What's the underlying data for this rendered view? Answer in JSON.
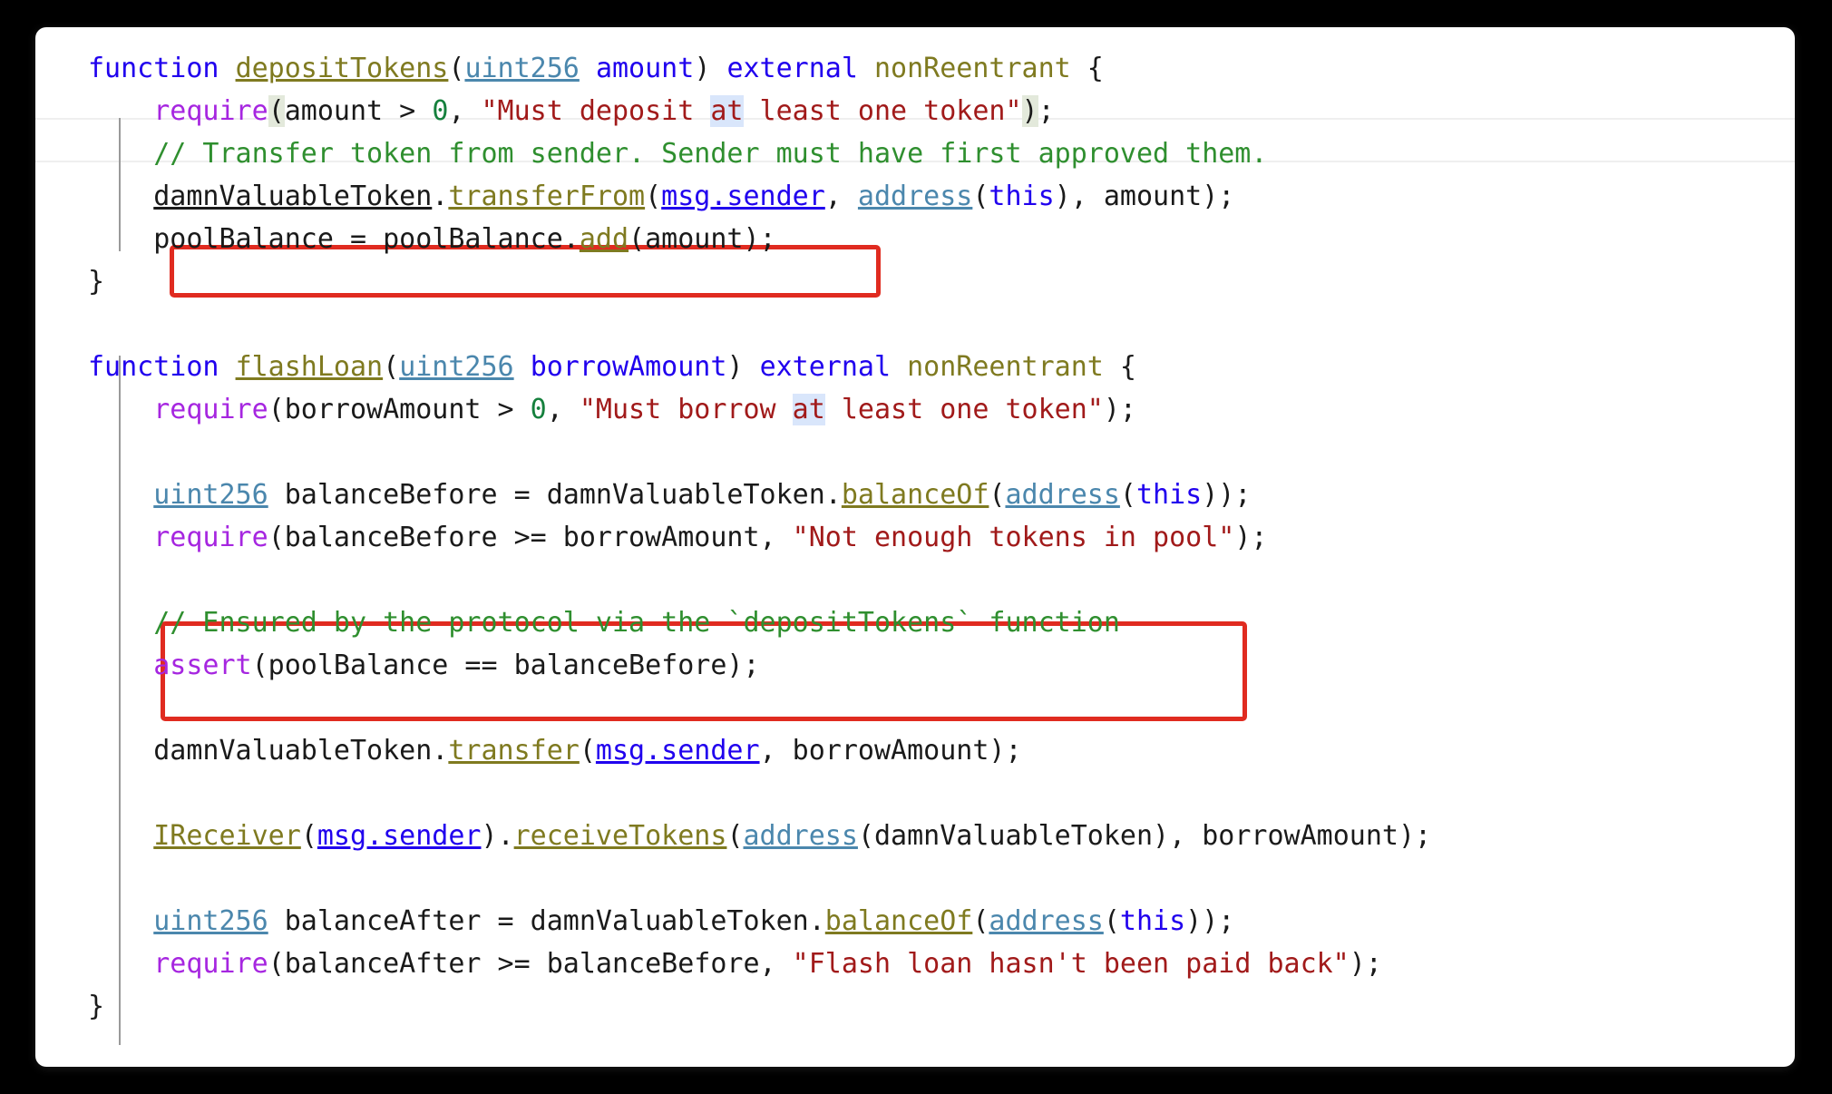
{
  "window": {
    "kind": "code-snippet-screenshot",
    "background_color": "#000000",
    "card_color": "#ffffff",
    "language": "Solidity"
  },
  "theme": {
    "keyword_color": "#2000ee",
    "function_color": "#7f7a20",
    "type_color": "#4b87ad",
    "builtin_color": "#a626e0",
    "string_color": "#a11a1a",
    "number_color": "#15803d",
    "comment_color": "#2f8f2f",
    "text_color": "#1a1a1a",
    "bracket_match_bg": "#e3e9db",
    "occurrence_bg": "#d9e6fb",
    "annotation_box_color": "#e02b20",
    "current_line_rule": "#efefef",
    "indent_guide": "#9a9a9a"
  },
  "annotations": [
    {
      "id": "redbox-1",
      "label": "pool-balance-update-highlight",
      "targets": "poolBalance = poolBalance.add(amount);"
    },
    {
      "id": "redbox-2",
      "label": "assert-invariant-highlight",
      "targets": "// Ensured by the protocol via the `depositTokens` function / assert(poolBalance == balanceBefore);"
    }
  ],
  "code": {
    "lines": [
      "function depositTokens(uint256 amount) external nonReentrant {",
      "    require(amount > 0, \"Must deposit at least one token\");",
      "    // Transfer token from sender. Sender must have first approved them.",
      "    damnValuableToken.transferFrom(msg.sender, address(this), amount);",
      "    poolBalance = poolBalance.add(amount);",
      "}",
      "",
      "function flashLoan(uint256 borrowAmount) external nonReentrant {",
      "    require(borrowAmount > 0, \"Must borrow at least one token\");",
      "",
      "    uint256 balanceBefore = damnValuableToken.balanceOf(address(this));",
      "    require(balanceBefore >= borrowAmount, \"Not enough tokens in pool\");",
      "",
      "    // Ensured by the protocol via the `depositTokens` function",
      "    assert(poolBalance == balanceBefore);",
      "",
      "    damnValuableToken.transfer(msg.sender, borrowAmount);",
      "",
      "    IReceiver(msg.sender).receiveTokens(address(damnValuableToken), borrowAmount);",
      "",
      "    uint256 balanceAfter = damnValuableToken.balanceOf(address(this));",
      "    require(balanceAfter >= balanceBefore, \"Flash loan hasn't been paid back\");",
      "}"
    ],
    "tokens": {
      "kw_function": "function",
      "kw_external": "external",
      "modifier_nonReentrant": "nonReentrant",
      "fn_depositTokens": "depositTokens",
      "fn_flashLoan": "flashLoan",
      "type_uint256": "uint256",
      "type_address": "address",
      "builtin_require": "require",
      "builtin_assert": "assert",
      "var_amount": "amount",
      "var_borrowAmount": "borrowAmount",
      "var_poolBalance": "poolBalance",
      "var_balanceBefore": "balanceBefore",
      "var_balanceAfter": "balanceAfter",
      "obj_damnValuableToken": "damnValuableToken",
      "obj_msg_sender": "msg.sender",
      "kw_this": "this",
      "iface_IReceiver": "IReceiver",
      "m_transferFrom": "transferFrom",
      "m_transfer": "transfer",
      "m_balanceOf": "balanceOf",
      "m_add": "add",
      "m_receiveTokens": "receiveTokens",
      "num_zero": "0",
      "str_must_deposit": "\"Must deposit at least one token\"",
      "str_must_borrow": "\"Must borrow at least one token\"",
      "str_not_enough": "\"Not enough tokens in pool\"",
      "str_not_paid_back": "\"Flash loan hasn't been paid back\"",
      "cmt_transfer": "// Transfer token from sender. Sender must have first approved them.",
      "cmt_ensured": "// Ensured by the protocol via the `depositTokens` function"
    },
    "pieces": {
      "l1_a": "function ",
      "l1_b": "depositTokens",
      "l1_c": "(",
      "l1_d": "uint256",
      "l1_e": " ",
      "l1_f": "amount",
      "l1_g": ") ",
      "l1_h": "external",
      "l1_i": " ",
      "l1_j": "nonReentrant",
      "l1_k": " {",
      "l2_indent": "    ",
      "l2_req": "require",
      "l2_open": "(",
      "l2_amount": "amount",
      "l2_gt": " > ",
      "l2_zero": "0",
      "l2_comma": ", ",
      "l2_str_a": "\"Must deposit ",
      "l2_str_at": "at",
      "l2_str_b": " least one token\"",
      "l2_close": ")",
      "l2_semi": ";",
      "l3_indent": "    ",
      "l3_cmt": "// Transfer token from sender. Sender must have first approved them.",
      "l4_indent": "    ",
      "l4_obj": "damnValuableToken",
      "l4_dot": ".",
      "l4_m": "transferFrom",
      "l4_p1": "(",
      "l4_msg": "msg.sender",
      "l4_p2": ", ",
      "l4_addr": "address",
      "l4_p3": "(",
      "l4_this": "this",
      "l4_p4": "), ",
      "l4_amount": "amount",
      "l4_p5": ");",
      "l5_indent": "    ",
      "l5_a": "poolBalance = poolBalance",
      "l5_dot": ".",
      "l5_add": "add",
      "l5_b": "(amount);",
      "l6": "}",
      "l8_a": "function ",
      "l8_b": "flashLoan",
      "l8_c": "(",
      "l8_d": "uint256",
      "l8_e": " ",
      "l8_f": "borrowAmount",
      "l8_g": ") ",
      "l8_h": "external",
      "l8_i": " ",
      "l8_j": "nonReentrant",
      "l8_k": " {",
      "l9_indent": "    ",
      "l9_req": "require",
      "l9_a": "(borrowAmount > ",
      "l9_zero": "0",
      "l9_comma": ", ",
      "l9_str_a": "\"Must borrow ",
      "l9_str_at": "at",
      "l9_str_b": " least one token\"",
      "l9_end": ");",
      "l11_indent": "    ",
      "l11_type": "uint256",
      "l11_mid": " balanceBefore = damnValuableToken",
      "l11_dot": ".",
      "l11_m": "balanceOf",
      "l11_p1": "(",
      "l11_addr": "address",
      "l11_p2": "(",
      "l11_this": "this",
      "l11_p3": "));",
      "l12_indent": "    ",
      "l12_req": "require",
      "l12_a": "(balanceBefore >= borrowAmount, ",
      "l12_str": "\"Not enough tokens in pool\"",
      "l12_end": ");",
      "l14_indent": "    ",
      "l14_cmt": "// Ensured by the protocol via the `depositTokens` function",
      "l15_indent": "    ",
      "l15_assert": "assert",
      "l15_rest": "(poolBalance == balanceBefore);",
      "l17_indent": "    ",
      "l17_obj": "damnValuableToken",
      "l17_dot": ".",
      "l17_m": "transfer",
      "l17_p1": "(",
      "l17_msg": "msg.sender",
      "l17_end": ", borrowAmount);",
      "l19_indent": "    ",
      "l19_iface": "IReceiver",
      "l19_p1": "(",
      "l19_msg": "msg.sender",
      "l19_p2": ")",
      "l19_dot": ".",
      "l19_m": "receiveTokens",
      "l19_p3": "(",
      "l19_addr": "address",
      "l19_p4": "(damnValuableToken), borrowAmount);",
      "l21_indent": "    ",
      "l21_type": "uint256",
      "l21_mid": " balanceAfter = damnValuableToken",
      "l21_dot": ".",
      "l21_m": "balanceOf",
      "l21_p1": "(",
      "l21_addr": "address",
      "l21_p2": "(",
      "l21_this": "this",
      "l21_p3": "));",
      "l22_indent": "    ",
      "l22_req": "require",
      "l22_a": "(balanceAfter >= balanceBefore, ",
      "l22_str": "\"Flash loan hasn't been paid back\"",
      "l22_end": ");",
      "l23": "}"
    }
  }
}
